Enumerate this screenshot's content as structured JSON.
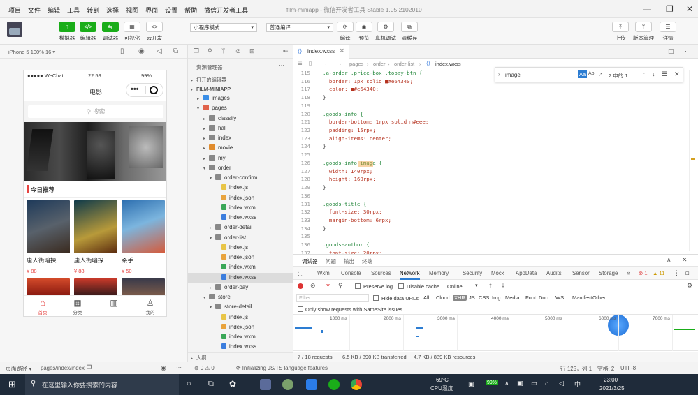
{
  "menubar": {
    "items": [
      "项目",
      "文件",
      "编辑",
      "工具",
      "转到",
      "选择",
      "视图",
      "界面",
      "设置",
      "帮助",
      "微信开发者工具"
    ],
    "window_title": "film-miniapp - 微信开发者工具 Stable 1.05.2102010"
  },
  "toolbar": {
    "left": [
      {
        "label": "模拟器",
        "icon": "phone-icon"
      },
      {
        "label": "编辑器",
        "icon": "code-icon"
      },
      {
        "label": "调试器",
        "icon": "debug-icon"
      },
      {
        "label": "可视化",
        "icon": "grid-icon"
      },
      {
        "label": "云开发",
        "icon": "cloud-icon"
      }
    ],
    "mode_select": "小程序模式",
    "compile_select": "普通编译",
    "right_left": [
      {
        "label": "编译",
        "icon": "refresh-icon"
      },
      {
        "label": "预览",
        "icon": "eye-icon"
      },
      {
        "label": "真机调试",
        "icon": "bug-icon"
      },
      {
        "label": "清缓存",
        "icon": "layers-icon"
      }
    ],
    "right": [
      {
        "label": "上传",
        "icon": "upload-icon"
      },
      {
        "label": "版本管理",
        "icon": "branch-icon"
      },
      {
        "label": "详情",
        "icon": "menu-icon"
      }
    ]
  },
  "simulator": {
    "device": "iPhone 5 100% 16 ▾",
    "status": {
      "carrier": "●●●●● WeChat",
      "time": "22:59",
      "battery": "99%"
    },
    "nav_title": "电影",
    "search_placeholder": "搜索",
    "section_title": "今日推荐",
    "movies": [
      {
        "title": "唐人街暗探",
        "price": "¥ 88"
      },
      {
        "title": "唐人街暗探",
        "price": "¥ 88"
      },
      {
        "title": "杀手",
        "price": "¥ 50"
      }
    ],
    "tabs": [
      {
        "label": "首页",
        "icon": "home-icon"
      },
      {
        "label": "分类",
        "icon": "category-icon"
      },
      {
        "label": "我的",
        "icon": "user-icon"
      }
    ]
  },
  "explorer": {
    "title": "资源管理器",
    "more": "···",
    "open_editors": "打开的编辑器",
    "project": "FILM-MINIAPP",
    "tree": [
      {
        "depth": 1,
        "label": "images",
        "type": "folder",
        "state": "collapsed",
        "color": "#3a8ee6"
      },
      {
        "depth": 1,
        "label": "pages",
        "type": "folder",
        "state": "expanded",
        "color": "#e0624b"
      },
      {
        "depth": 2,
        "label": "classify",
        "type": "folder",
        "state": "collapsed",
        "color": "#888"
      },
      {
        "depth": 2,
        "label": "hall",
        "type": "folder",
        "state": "collapsed",
        "color": "#888"
      },
      {
        "depth": 2,
        "label": "index",
        "type": "folder",
        "state": "collapsed",
        "color": "#888"
      },
      {
        "depth": 2,
        "label": "movie",
        "type": "folder",
        "state": "collapsed",
        "color": "#e08b2c"
      },
      {
        "depth": 2,
        "label": "my",
        "type": "folder",
        "state": "collapsed",
        "color": "#888"
      },
      {
        "depth": 2,
        "label": "order",
        "type": "folder",
        "state": "expanded",
        "color": "#888"
      },
      {
        "depth": 3,
        "label": "order-confirm",
        "type": "folder",
        "state": "expanded",
        "color": "#888"
      },
      {
        "depth": 4,
        "label": "index.js",
        "type": "js",
        "color": "#e8c547"
      },
      {
        "depth": 4,
        "label": "index.json",
        "type": "json",
        "color": "#e8a33d"
      },
      {
        "depth": 4,
        "label": "index.wxml",
        "type": "wxml",
        "color": "#3aa757"
      },
      {
        "depth": 4,
        "label": "index.wxss",
        "type": "wxss",
        "color": "#3b7ddd"
      },
      {
        "depth": 3,
        "label": "order-detail",
        "type": "folder",
        "state": "collapsed",
        "color": "#888"
      },
      {
        "depth": 3,
        "label": "order-list",
        "type": "folder",
        "state": "expanded",
        "color": "#888"
      },
      {
        "depth": 4,
        "label": "index.js",
        "type": "js",
        "color": "#e8c547"
      },
      {
        "depth": 4,
        "label": "index.json",
        "type": "json",
        "color": "#e8a33d"
      },
      {
        "depth": 4,
        "label": "index.wxml",
        "type": "wxml",
        "color": "#3aa757"
      },
      {
        "depth": 4,
        "label": "index.wxss",
        "type": "wxss",
        "color": "#3b7ddd",
        "selected": true
      },
      {
        "depth": 3,
        "label": "order-pay",
        "type": "folder",
        "state": "collapsed",
        "color": "#888"
      },
      {
        "depth": 2,
        "label": "store",
        "type": "folder",
        "state": "expanded",
        "color": "#888"
      },
      {
        "depth": 3,
        "label": "store-detail",
        "type": "folder",
        "state": "expanded",
        "color": "#888"
      },
      {
        "depth": 4,
        "label": "index.js",
        "type": "js",
        "color": "#e8c547"
      },
      {
        "depth": 4,
        "label": "index.json",
        "type": "json",
        "color": "#e8a33d"
      },
      {
        "depth": 4,
        "label": "index.wxml",
        "type": "wxml",
        "color": "#3aa757"
      },
      {
        "depth": 4,
        "label": "index.wxss",
        "type": "wxss",
        "color": "#3b7ddd"
      }
    ],
    "outline": "大纲"
  },
  "editor": {
    "tab": "index.wxss",
    "breadcrumb": [
      "pages",
      "order",
      "order-list",
      "index.wxss"
    ],
    "lines": [
      {
        "n": "115",
        "t": ".a-order .price-box .topay-btn {"
      },
      {
        "n": "116",
        "t": "  border: 1px solid ■#e64340;"
      },
      {
        "n": "117",
        "t": "  color: ■#e64340;"
      },
      {
        "n": "118",
        "t": "}"
      },
      {
        "n": "119",
        "t": ""
      },
      {
        "n": "120",
        "t": ".goods-info {"
      },
      {
        "n": "121",
        "t": "  border-bottom: 1rpx solid □#eee;"
      },
      {
        "n": "122",
        "t": "  padding: 15rpx;"
      },
      {
        "n": "123",
        "t": "  align-items: center;"
      },
      {
        "n": "124",
        "t": "}"
      },
      {
        "n": "125",
        "t": ""
      },
      {
        "n": "126",
        "t": ".goods-info image {"
      },
      {
        "n": "127",
        "t": "  width: 140rpx;"
      },
      {
        "n": "128",
        "t": "  height: 160rpx;"
      },
      {
        "n": "129",
        "t": "}"
      },
      {
        "n": "130",
        "t": ""
      },
      {
        "n": "131",
        "t": ".goods-title {"
      },
      {
        "n": "132",
        "t": "  font-size: 30rpx;"
      },
      {
        "n": "133",
        "t": "  margin-bottom: 6rpx;"
      },
      {
        "n": "134",
        "t": "}"
      },
      {
        "n": "135",
        "t": ""
      },
      {
        "n": "136",
        "t": ".goods-author {"
      },
      {
        "n": "137",
        "t": "  font-size: 20rpx;"
      }
    ],
    "find": {
      "value": "image",
      "count": "2 中的 1",
      "aa": "Aa",
      "ab": "Ab|",
      "regex": ".*"
    }
  },
  "devtools": {
    "top_tabs": [
      "调试器",
      "问题",
      "输出",
      "终端"
    ],
    "tabs": [
      "Wxml",
      "Console",
      "Sources",
      "Network",
      "Memory",
      "Security",
      "Mock",
      "AppData",
      "Audits",
      "Sensor",
      "Storage"
    ],
    "active_tab": "Network",
    "more": "»",
    "errors": "1",
    "warnings": "11",
    "preserve_log": "Preserve log",
    "disable_cache": "Disable cache",
    "throttle": "Online",
    "filter_placeholder": "Filter",
    "hide_data_urls": "Hide data URLs",
    "filter_types": [
      "All",
      "Cloud",
      "XHR",
      "JS",
      "CSS",
      "Img",
      "Media",
      "Font",
      "Doc",
      "WS",
      "Manifest",
      "Other"
    ],
    "active_filter": "XHR",
    "samesite": "Only show requests with SameSite issues",
    "ticks": [
      "1000 ms",
      "2000 ms",
      "3000 ms",
      "4000 ms",
      "5000 ms",
      "6000 ms",
      "7000 ms"
    ],
    "summary": [
      "7 / 18 requests",
      "6.5 KB / 890 KB transferred",
      "4.7 KB / 889 KB resources"
    ]
  },
  "statusbar": {
    "path_label": "页面路径 ▾",
    "path": "pages/index/index",
    "errors": "0",
    "warnings": "0",
    "message": "Initializing JS/TS language features",
    "position": "行 125，列 1",
    "spaces": "空格: 2",
    "encoding": "UTF-8"
  },
  "taskbar": {
    "search_placeholder": "在这里输入你要搜索的内容",
    "temp": "69°C",
    "cpu": "CPU温度",
    "battery": "99%",
    "time": "23:00",
    "date": "2021/3/25",
    "ime": "中"
  }
}
